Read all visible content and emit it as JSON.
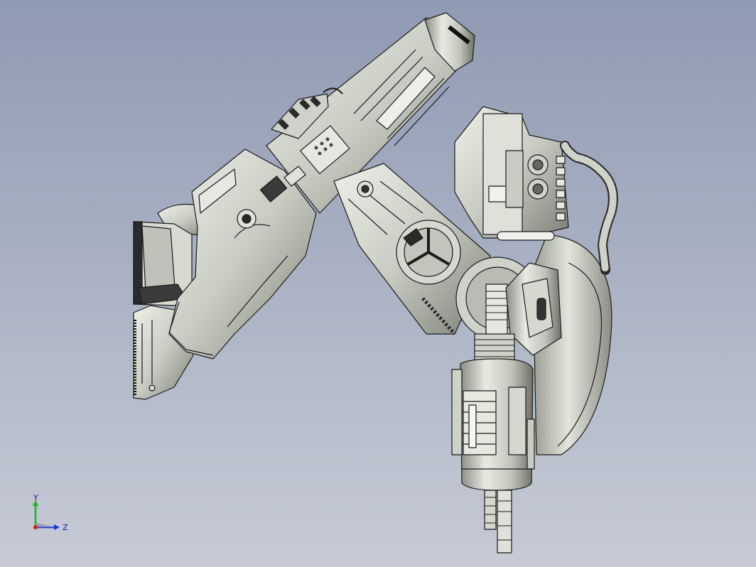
{
  "viewport": {
    "background_top": "#8f9ab3",
    "background_bottom": "#c6cbd5",
    "model": {
      "name": "mechanical-arm-model",
      "body_color": "#cfd2c9",
      "shadow_color": "#6f7268",
      "dark_color": "#2a2a2a",
      "line_color": "#1b1b1b"
    }
  },
  "triad": {
    "y_label": "Y",
    "z_label": "Z",
    "y_color": "#1fb31f",
    "z_color": "#1a32d6",
    "x_color": "#d61a1a"
  }
}
